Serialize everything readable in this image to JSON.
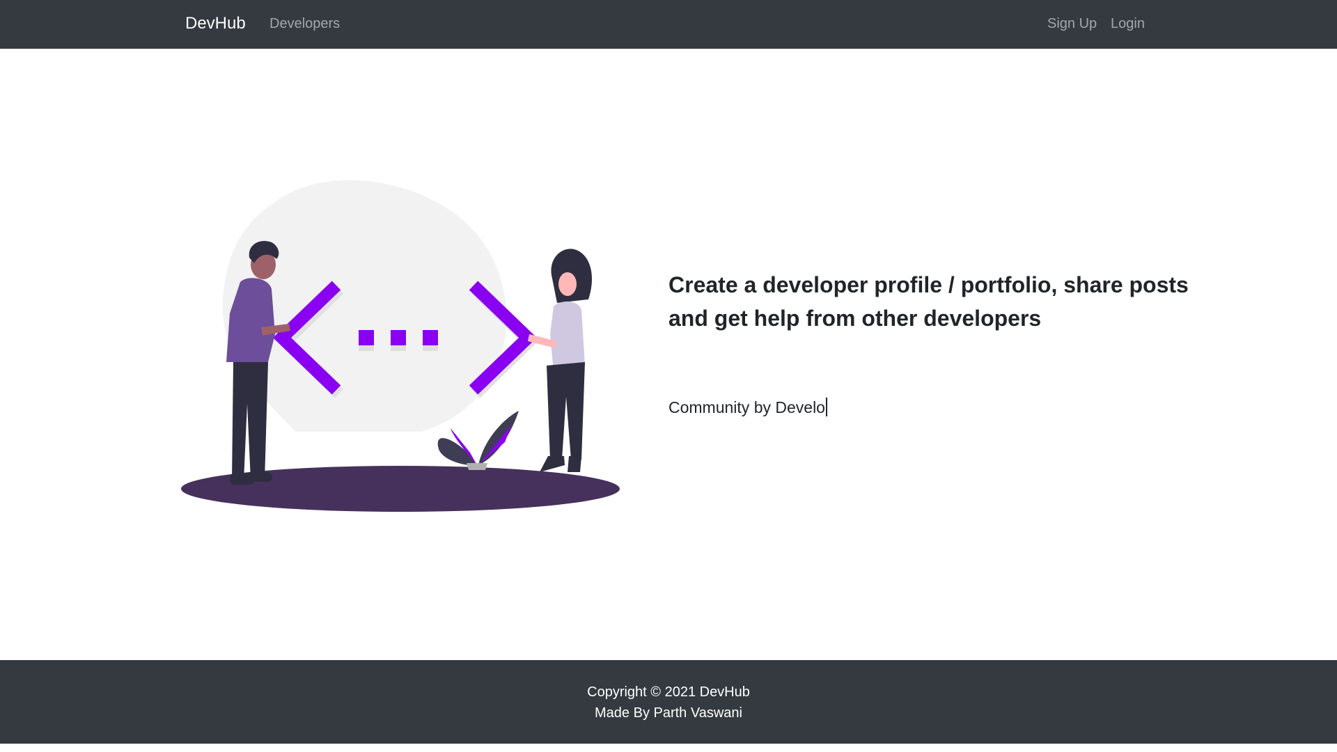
{
  "navbar": {
    "brand": "DevHub",
    "links": [
      "Developers"
    ],
    "auth": [
      "Sign Up",
      "Login"
    ],
    "background": "#343a40"
  },
  "hero": {
    "headline": "Create a developer profile / portfolio, share posts and get help from other developers",
    "typed_text": "Community by Develo",
    "illustration_icon": "code-collaboration-illustration",
    "accent": "#8a00f0"
  },
  "footer": {
    "copyright": "Copyright © 2021 DevHub",
    "credit": "Made By Parth Vaswani"
  }
}
